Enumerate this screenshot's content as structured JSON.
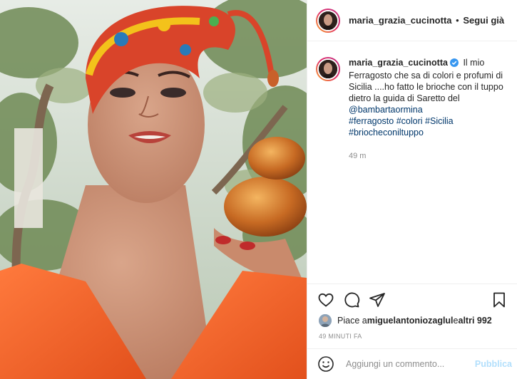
{
  "post": {
    "author": "maria_grazia_cucinotta",
    "header_separator": "•",
    "follow_label": "Segui già"
  },
  "caption": {
    "username": "maria_grazia_cucinotta",
    "text": "Il mio Ferragosto che sa di colori e profumi di Sicilia ....ho fatto le brioche con il tuppo dietro la guida di Saretto del",
    "mention": "@bambartaormina",
    "hashtags": [
      "#ferragosto",
      "#colori",
      "#Sicilia",
      "#briocheconiltuppo"
    ],
    "time": "49 m"
  },
  "icons": {
    "like": "heart-icon",
    "comment": "comment-icon",
    "share": "paper-plane-icon",
    "save": "bookmark-icon",
    "emoji": "smiley-icon",
    "verified": "verified-badge-icon"
  },
  "likes": {
    "prefix": "Piace a ",
    "user": "miguelantoniozaglul",
    "middle": " e ",
    "others": "altri 992"
  },
  "posted_time": "49 MINUTI FA",
  "comment_box": {
    "placeholder": "Aggiungi un commento...",
    "publish_label": "Pubblica"
  },
  "colors": {
    "verified": "#3897f0",
    "link": "#00376b",
    "publish_disabled": "#b2dffc",
    "dress": "#f2612b"
  }
}
